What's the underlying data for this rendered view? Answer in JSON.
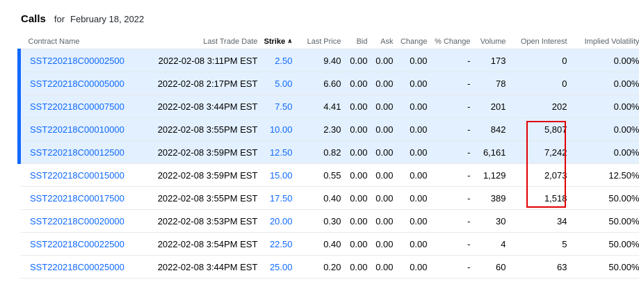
{
  "header": {
    "title": "Calls",
    "for": "for",
    "date": "February 18, 2022"
  },
  "columns": {
    "contract": "Contract Name",
    "last_trade_date": "Last Trade Date",
    "strike": "Strike",
    "last_price": "Last Price",
    "bid": "Bid",
    "ask": "Ask",
    "change": "Change",
    "pct_change": "% Change",
    "volume": "Volume",
    "open_interest": "Open Interest",
    "implied_volatility": "Implied Volatility"
  },
  "icons": {
    "sort_ascending": "chevron-up-icon"
  },
  "colors": {
    "link": "#0f69ff",
    "in_the_money_bg": "#e3f0ff",
    "in_the_money_bar": "#0f69ff",
    "highlight": "#e00000"
  },
  "rows": [
    {
      "contract": "SST220218C00002500",
      "last_trade_date": "2022-02-08 3:11PM EST",
      "strike": "2.50",
      "last_price": "9.40",
      "bid": "0.00",
      "ask": "0.00",
      "change": "0.00",
      "pct_change": "-",
      "volume": "173",
      "open_interest": "0",
      "implied_volatility": "0.00%",
      "in_the_money": true
    },
    {
      "contract": "SST220218C00005000",
      "last_trade_date": "2022-02-08 2:17PM EST",
      "strike": "5.00",
      "last_price": "6.60",
      "bid": "0.00",
      "ask": "0.00",
      "change": "0.00",
      "pct_change": "-",
      "volume": "78",
      "open_interest": "0",
      "implied_volatility": "0.00%",
      "in_the_money": true
    },
    {
      "contract": "SST220218C00007500",
      "last_trade_date": "2022-02-08 3:44PM EST",
      "strike": "7.50",
      "last_price": "4.41",
      "bid": "0.00",
      "ask": "0.00",
      "change": "0.00",
      "pct_change": "-",
      "volume": "201",
      "open_interest": "202",
      "implied_volatility": "0.00%",
      "in_the_money": true
    },
    {
      "contract": "SST220218C00010000",
      "last_trade_date": "2022-02-08 3:55PM EST",
      "strike": "10.00",
      "last_price": "2.30",
      "bid": "0.00",
      "ask": "0.00",
      "change": "0.00",
      "pct_change": "-",
      "volume": "842",
      "open_interest": "5,807",
      "implied_volatility": "0.00%",
      "in_the_money": true
    },
    {
      "contract": "SST220218C00012500",
      "last_trade_date": "2022-02-08 3:59PM EST",
      "strike": "12.50",
      "last_price": "0.82",
      "bid": "0.00",
      "ask": "0.00",
      "change": "0.00",
      "pct_change": "-",
      "volume": "6,161",
      "open_interest": "7,242",
      "implied_volatility": "0.00%",
      "in_the_money": true
    },
    {
      "contract": "SST220218C00015000",
      "last_trade_date": "2022-02-08 3:59PM EST",
      "strike": "15.00",
      "last_price": "0.55",
      "bid": "0.00",
      "ask": "0.00",
      "change": "0.00",
      "pct_change": "-",
      "volume": "1,129",
      "open_interest": "2,073",
      "implied_volatility": "12.50%",
      "in_the_money": false
    },
    {
      "contract": "SST220218C00017500",
      "last_trade_date": "2022-02-08 3:55PM EST",
      "strike": "17.50",
      "last_price": "0.40",
      "bid": "0.00",
      "ask": "0.00",
      "change": "0.00",
      "pct_change": "-",
      "volume": "389",
      "open_interest": "1,518",
      "implied_volatility": "50.00%",
      "in_the_money": false
    },
    {
      "contract": "SST220218C00020000",
      "last_trade_date": "2022-02-08 3:53PM EST",
      "strike": "20.00",
      "last_price": "0.30",
      "bid": "0.00",
      "ask": "0.00",
      "change": "0.00",
      "pct_change": "-",
      "volume": "30",
      "open_interest": "34",
      "implied_volatility": "50.00%",
      "in_the_money": false
    },
    {
      "contract": "SST220218C00022500",
      "last_trade_date": "2022-02-08 3:54PM EST",
      "strike": "22.50",
      "last_price": "0.40",
      "bid": "0.00",
      "ask": "0.00",
      "change": "0.00",
      "pct_change": "-",
      "volume": "4",
      "open_interest": "5",
      "implied_volatility": "50.00%",
      "in_the_money": false
    },
    {
      "contract": "SST220218C00025000",
      "last_trade_date": "2022-02-08 3:44PM EST",
      "strike": "25.00",
      "last_price": "0.20",
      "bid": "0.00",
      "ask": "0.00",
      "change": "0.00",
      "pct_change": "-",
      "volume": "60",
      "open_interest": "63",
      "implied_volatility": "50.00%",
      "in_the_money": false
    }
  ]
}
